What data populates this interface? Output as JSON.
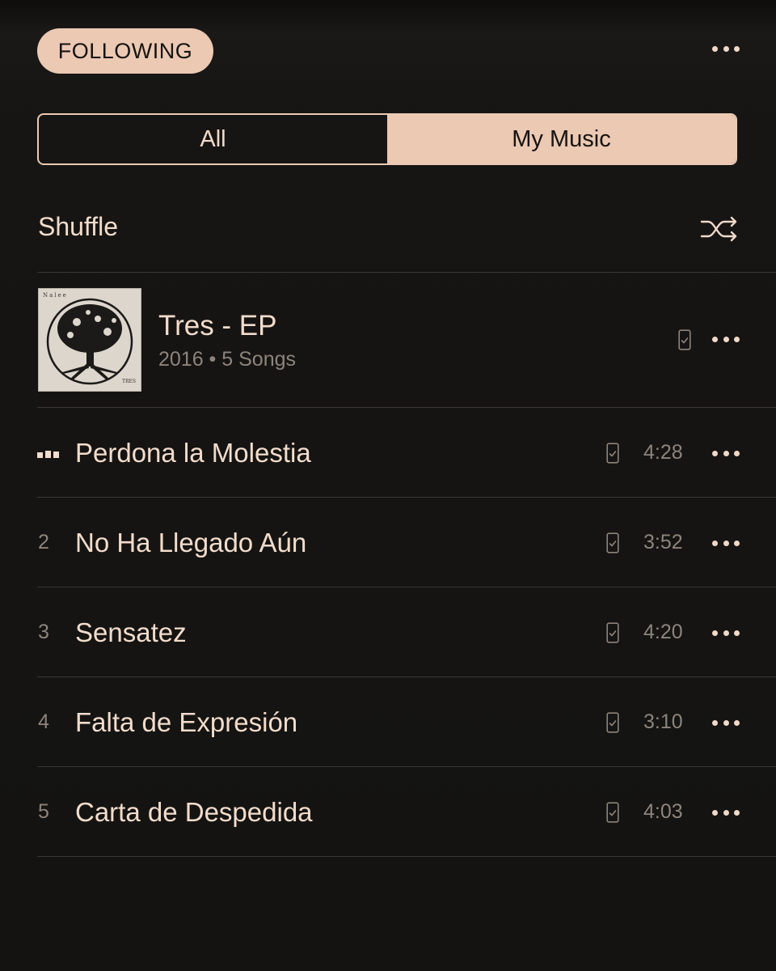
{
  "header": {
    "following_label": "FOLLOWING",
    "more_icon": "more-horizontal-icon"
  },
  "segment": {
    "all_label": "All",
    "my_music_label": "My Music",
    "selected": "My Music"
  },
  "shuffle": {
    "label": "Shuffle",
    "icon": "shuffle-icon"
  },
  "album": {
    "title": "Tres - EP",
    "meta": "2016 • 5 Songs",
    "art_text_top": "Nalee",
    "art_text_bottom": "TRES"
  },
  "tracks": [
    {
      "number": "",
      "title": "Perdona la Molestia",
      "duration": "4:28",
      "now_playing": true
    },
    {
      "number": "2",
      "title": "No Ha Llegado Aún",
      "duration": "3:52",
      "now_playing": false
    },
    {
      "number": "3",
      "title": "Sensatez",
      "duration": "4:20",
      "now_playing": false
    },
    {
      "number": "4",
      "title": "Falta de Expresión",
      "duration": "3:10",
      "now_playing": false
    },
    {
      "number": "5",
      "title": "Carta de Despedida",
      "duration": "4:03",
      "now_playing": false
    }
  ],
  "colors": {
    "accent": "#ecc9b3",
    "background": "#141311",
    "text_primary": "#f2dccb",
    "text_secondary": "#8c847d",
    "divider": "#3a3735"
  }
}
